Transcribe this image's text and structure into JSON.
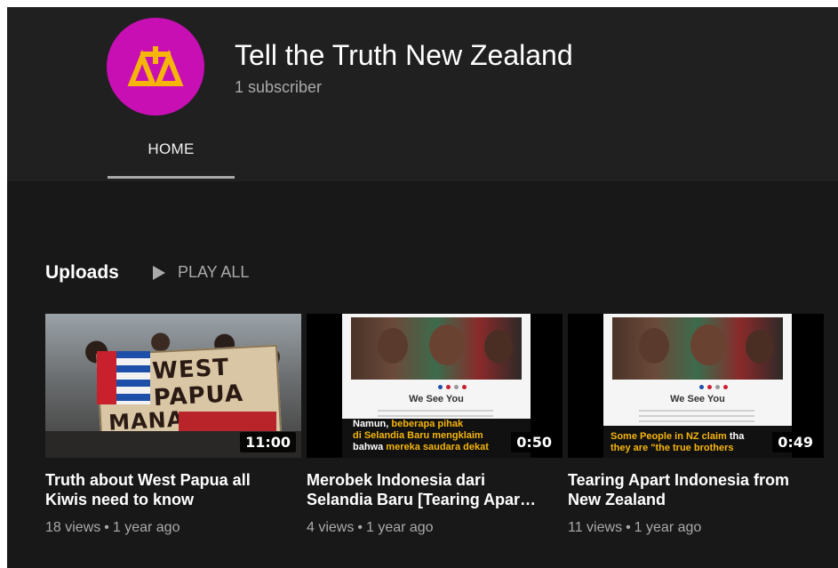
{
  "channel": {
    "name": "Tell the Truth New Zealand",
    "subscribers": "1 subscriber",
    "avatar_color": "#c70fb4",
    "avatar_icon": "scales-icon"
  },
  "tabs": [
    {
      "label": "HOME",
      "active": true
    }
  ],
  "uploads": {
    "title": "Uploads",
    "play_all": "PLAY ALL"
  },
  "videos": [
    {
      "title": "Truth about West Papua all Kiwis need to know",
      "duration": "11:00",
      "views": "18 views",
      "age": "1 year ago",
      "thumb": {
        "banner_top": "WEST PAPUA",
        "banner_bottom": "MANA MOTUHAKE"
      }
    },
    {
      "title": "Merobek Indonesia dari Selandia Baru [Tearing Apar…",
      "duration": "0:50",
      "views": "4 views",
      "age": "1 year ago",
      "thumb": {
        "heading": "We See You",
        "caption_white_1": "Namun,",
        "caption_yellow_1": "beberapa pihak",
        "caption_yellow_2": "di Selandia Baru mengklaim",
        "caption_white_2": "bahwa",
        "caption_yellow_3": "mereka saudara dekat"
      }
    },
    {
      "title": "Tearing Apart Indonesia from New Zealand",
      "duration": "0:49",
      "views": "11 views",
      "age": "1 year ago",
      "thumb": {
        "heading": "We See You",
        "caption_yellow_1": "Some People in NZ claim",
        "caption_white_1": "tha",
        "caption_yellow_2": "they are \"the true brothers"
      }
    }
  ],
  "colors": {
    "background": "#181818",
    "header": "#202020",
    "text_primary": "#ffffff",
    "text_secondary": "#aaaaaa",
    "caption_yellow": "#f5b50a"
  }
}
